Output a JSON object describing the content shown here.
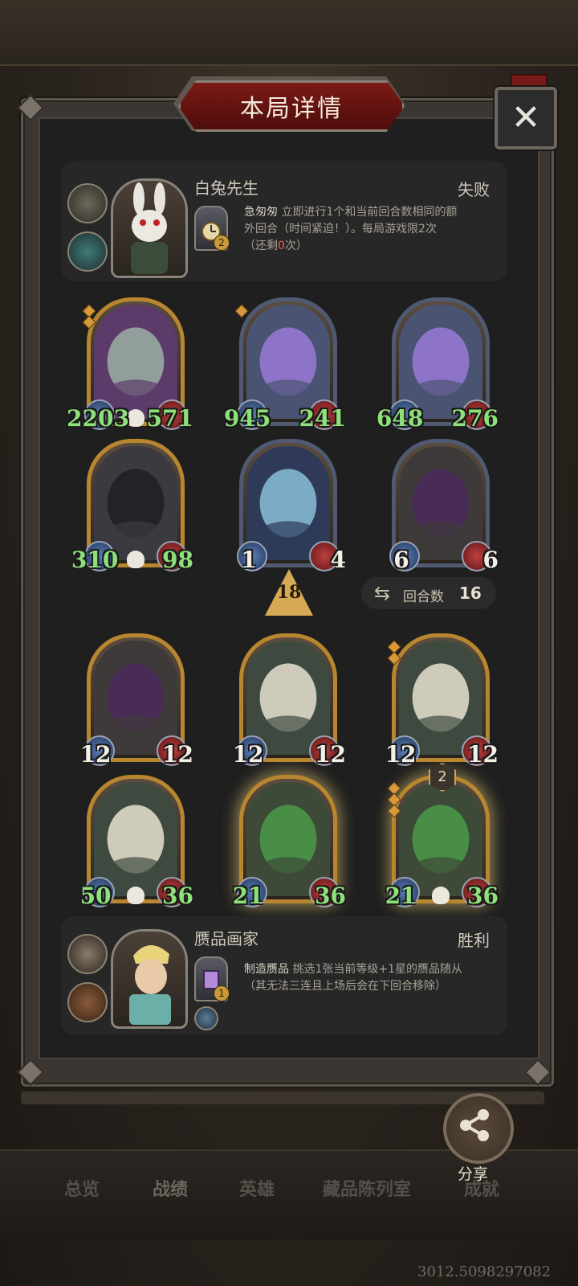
{
  "title": "本局详情",
  "close_label": "✕",
  "top_player": {
    "name": "白兔先生",
    "result": "失败",
    "skill_level": "2",
    "skill_title": "急匆匆",
    "skill_line1_rest": " 立即进行1个和当前回合数相同的额",
    "skill_line2": "外回合（时间紧迫！）。每局游戏限2次",
    "skill_line3_pre": "（还剩",
    "skill_line3_num": "0",
    "skill_line3_post": "次）"
  },
  "top_board": [
    {
      "atk": "2203",
      "hp": "571",
      "atk_color": "#8ee07a",
      "hp_color": "#8ee07a",
      "skull": true,
      "frame": "gold",
      "art": "nun",
      "diamonds": 2
    },
    {
      "atk": "945",
      "hp": "241",
      "atk_color": "#8ee07a",
      "hp_color": "#8ee07a",
      "skull": false,
      "frame": "blue",
      "art": "girl",
      "diamonds": 1
    },
    {
      "atk": "648",
      "hp": "276",
      "atk_color": "#8ee07a",
      "hp_color": "#8ee07a",
      "skull": false,
      "frame": "blue",
      "art": "girl",
      "diamonds": 0
    },
    {
      "atk": "310",
      "hp": "98",
      "atk_color": "#8ee07a",
      "hp_color": "#8ee07a",
      "skull": true,
      "frame": "gold",
      "art": "dark",
      "diamonds": 0
    },
    {
      "atk": "1",
      "hp": "4",
      "atk_color": "#f2efe6",
      "hp_color": "#f2efe6",
      "skull": false,
      "frame": "blue",
      "art": "elf",
      "diamonds": 0
    },
    {
      "atk": "6",
      "hp": "6",
      "atk_color": "#f2efe6",
      "hp_color": "#f2efe6",
      "skull": false,
      "frame": "blue",
      "art": "dragon",
      "diamonds": 0
    }
  ],
  "middle": {
    "tier": "18",
    "round_label": "回合数",
    "round_value": "16"
  },
  "bottom_board": [
    {
      "atk": "12",
      "hp": "12",
      "atk_color": "#f2efe6",
      "hp_color": "#f2efe6",
      "skull": false,
      "frame": "gold",
      "art": "dragon",
      "diamonds": 0
    },
    {
      "atk": "12",
      "hp": "12",
      "atk_color": "#f2efe6",
      "hp_color": "#f2efe6",
      "skull": false,
      "frame": "gold",
      "art": "serpent",
      "diamonds": 0
    },
    {
      "atk": "12",
      "hp": "12",
      "atk_color": "#f2efe6",
      "hp_color": "#f2efe6",
      "skull": false,
      "frame": "gold",
      "art": "serpent",
      "diamonds": 2
    },
    {
      "atk": "50",
      "hp": "36",
      "atk_color": "#8ee07a",
      "hp_color": "#8ee07a",
      "skull": true,
      "frame": "gold",
      "art": "serpent",
      "diamonds": 0
    },
    {
      "atk": "21",
      "hp": "36",
      "atk_color": "#8ee07a",
      "hp_color": "#8ee07a",
      "skull": false,
      "frame": "gold",
      "art": "croc",
      "diamonds": 0,
      "glow": true
    },
    {
      "atk": "21",
      "hp": "36",
      "atk_color": "#8ee07a",
      "hp_color": "#8ee07a",
      "skull": true,
      "frame": "gold",
      "art": "croc",
      "diamonds": 3,
      "glow": true,
      "level": "2"
    }
  ],
  "bottom_player": {
    "name": "赝品画家",
    "result": "胜利",
    "skill_level": "1",
    "skill_title": "制造赝品",
    "skill_line1_rest": " 挑选1张当前等级+1星的赝品随从",
    "skill_line2": "（其无法三连且上场后会在下回合移除）"
  },
  "share_label": "分享",
  "tabs": [
    "总览",
    "战绩",
    "英雄",
    "藏品陈列室",
    "成就"
  ],
  "coord_text": "3012.5098297082"
}
